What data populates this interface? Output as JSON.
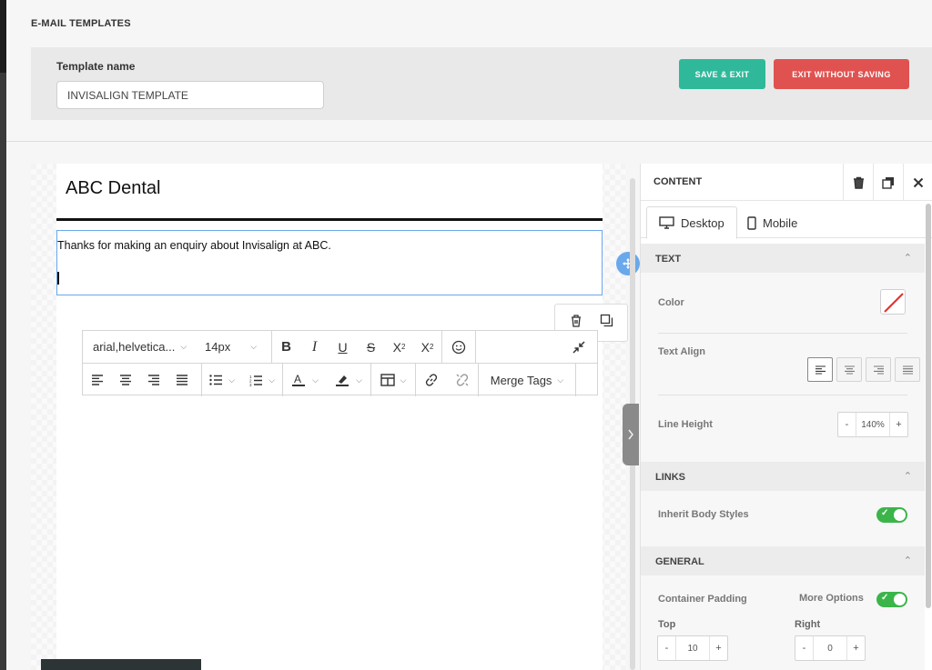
{
  "app": {
    "title": "E-MAIL TEMPLATES"
  },
  "header": {
    "template_name_label": "Template name",
    "template_name_value": "INVISALIGN TEMPLATE",
    "save_exit_label": "SAVE & EXIT",
    "exit_without_saving_label": "EXIT WITHOUT SAVING"
  },
  "email": {
    "brand": "ABC Dental",
    "paragraph": "Thanks for making an enquiry about Invisalign at ABC."
  },
  "toolbar": {
    "font_family": "arial,helvetica...",
    "font_size": "14px",
    "merge_tags_label": "Merge Tags"
  },
  "panel": {
    "title": "CONTENT",
    "tabs": [
      {
        "label": "Desktop"
      },
      {
        "label": "Mobile"
      }
    ],
    "text_section": {
      "title": "TEXT",
      "color_label": "Color",
      "text_align_label": "Text Align",
      "line_height_label": "Line Height",
      "line_height_value": "140%",
      "minus": "-",
      "plus": "+"
    },
    "links_section": {
      "title": "LINKS",
      "inherit_label": "Inherit Body Styles",
      "inherit_on": true
    },
    "general_section": {
      "title": "GENERAL",
      "container_padding_label": "Container Padding",
      "more_options_label": "More Options",
      "more_options_on": true,
      "top_label": "Top",
      "top_value": "10",
      "right_label": "Right",
      "right_value": "0"
    }
  },
  "colors": {
    "accent_blue": "#6aa8ec",
    "save_green": "#2fb99a",
    "exit_red": "#e05250",
    "toggle_green": "#3bb54a"
  }
}
